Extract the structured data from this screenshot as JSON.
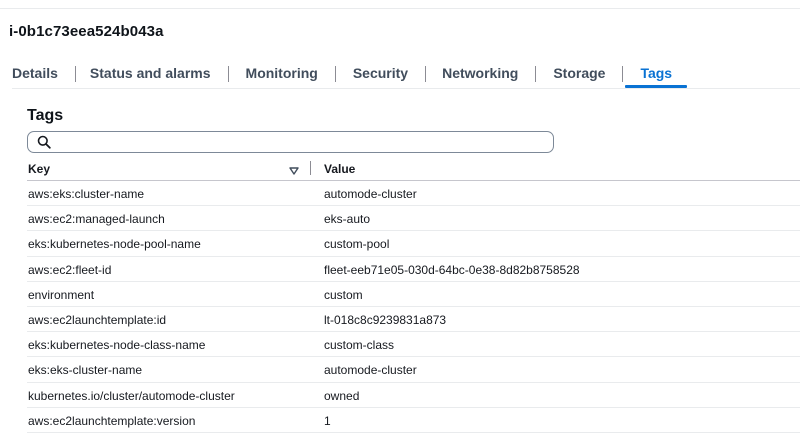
{
  "instance": {
    "id": "i-0b1c73eea524b043a"
  },
  "tabs": [
    {
      "label": "Details"
    },
    {
      "label": "Status and alarms"
    },
    {
      "label": "Monitoring"
    },
    {
      "label": "Security"
    },
    {
      "label": "Networking"
    },
    {
      "label": "Storage"
    },
    {
      "label": "Tags",
      "active": true
    }
  ],
  "tags_section": {
    "heading": "Tags",
    "search": {
      "value": "",
      "placeholder": ""
    },
    "columns": {
      "key": "Key",
      "value": "Value"
    },
    "rows": [
      {
        "key": "aws:eks:cluster-name",
        "value": "automode-cluster"
      },
      {
        "key": "aws:ec2:managed-launch",
        "value": "eks-auto"
      },
      {
        "key": "eks:kubernetes-node-pool-name",
        "value": "custom-pool"
      },
      {
        "key": "aws:ec2:fleet-id",
        "value": "fleet-eeb71e05-030d-64bc-0e38-8d82b8758528"
      },
      {
        "key": "environment",
        "value": "custom"
      },
      {
        "key": "aws:ec2launchtemplate:id",
        "value": "lt-018c8c9239831a873"
      },
      {
        "key": "eks:kubernetes-node-class-name",
        "value": "custom-class"
      },
      {
        "key": "eks:eks-cluster-name",
        "value": "automode-cluster"
      },
      {
        "key": "kubernetes.io/cluster/automode-cluster",
        "value": "owned"
      },
      {
        "key": "aws:ec2launchtemplate:version",
        "value": "1"
      }
    ]
  },
  "colors": {
    "accent": "#0972d3",
    "text": "#16191f",
    "tab_text": "#414d5c",
    "divider": "#e9ebed"
  },
  "icons": {
    "search": "search-icon",
    "sort": "sort-descending-icon"
  }
}
